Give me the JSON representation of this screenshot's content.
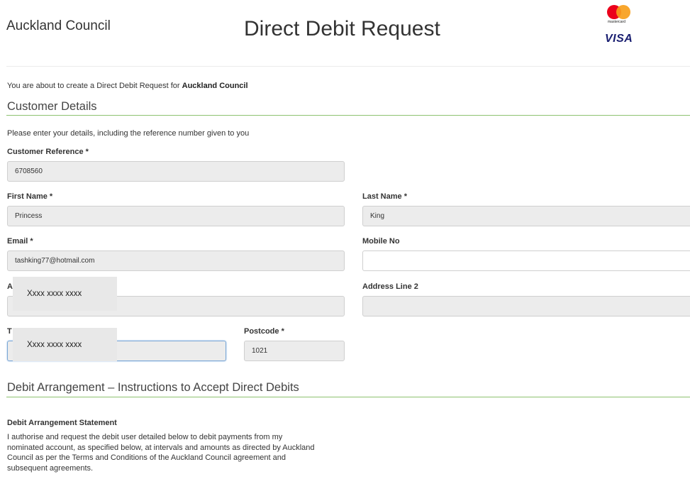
{
  "header": {
    "org_name": "Auckland Council",
    "page_title": "Direct Debit Request",
    "logos": {
      "mastercard_text": "mastercard",
      "visa_text": "VISA"
    }
  },
  "intro": {
    "text": "You are about to create a Direct Debit Request for ",
    "org_bold": "Auckland Council"
  },
  "customer_details": {
    "heading": "Customer Details",
    "instruction": "Please enter your details, including the reference number given to you",
    "fields": {
      "customer_reference": {
        "label": "Customer Reference *",
        "value": "6708560"
      },
      "first_name": {
        "label": "First Name *",
        "value": "Princess"
      },
      "last_name": {
        "label": "Last Name *",
        "value": "King"
      },
      "email": {
        "label": "Email *",
        "value": "tashking77@hotmail.com"
      },
      "mobile": {
        "label": "Mobile No",
        "value": ""
      },
      "address_line_1": {
        "label_visible": "A",
        "value": ""
      },
      "address_line_2": {
        "label": "Address Line 2",
        "value": ""
      },
      "town": {
        "label_visible": "T",
        "value": ""
      },
      "postcode": {
        "label": "Postcode *",
        "value": "1021"
      }
    },
    "masks": [
      "Xxxx xxxx xxxx",
      "Xxxx xxxx xxxx"
    ]
  },
  "debit_arrangement": {
    "heading": "Debit Arrangement – Instructions to Accept Direct Debits",
    "statement_title": "Debit Arrangement Statement",
    "statement_lines": [
      "I authorise and request the debit user detailed below to debit payments from my",
      "nominated account, as specified below, at intervals and amounts as directed by Auckland",
      "Council as per the Terms and Conditions of the Auckland Council agreement and",
      "subsequent agreements."
    ]
  }
}
